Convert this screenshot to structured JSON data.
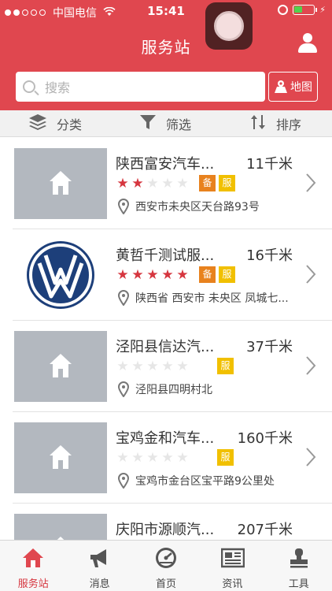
{
  "status_bar": {
    "carrier": "中国电信",
    "time": "15:41"
  },
  "header": {
    "title": "服务站"
  },
  "search": {
    "placeholder": "搜索",
    "map_label": "地图"
  },
  "filters": [
    {
      "label": "分类",
      "icon": "layers-icon"
    },
    {
      "label": "筛选",
      "icon": "funnel-icon"
    },
    {
      "label": "排序",
      "icon": "sort-arrows-icon"
    }
  ],
  "stations": [
    {
      "name": "陕西富安汽车...",
      "distance": "11千米",
      "rating": 2,
      "badges": [
        "备",
        "服"
      ],
      "address": "西安市未央区天台路93号",
      "image": "placeholder-house"
    },
    {
      "name": "黄哲千测试服...",
      "distance": "16千米",
      "rating": 5,
      "badges": [
        "备",
        "服"
      ],
      "address": "陕西省 西安市 未央区 凤城七...",
      "image": "vw-logo"
    },
    {
      "name": "泾阳县信达汽...",
      "distance": "37千米",
      "rating": 0,
      "badges": [
        "服"
      ],
      "address": "泾阳县四明村北",
      "image": "placeholder-house"
    },
    {
      "name": "宝鸡金和汽车...",
      "distance": "160千米",
      "rating": 0,
      "badges": [
        "服"
      ],
      "address": "宝鸡市金台区宝平路9公里处",
      "image": "placeholder-house"
    },
    {
      "name": "庆阳市源顺汽...",
      "distance": "207千米",
      "rating": 0,
      "badges": [],
      "address": "",
      "image": "placeholder-house"
    }
  ],
  "tabs": [
    {
      "label": "服务站",
      "icon": "house-icon",
      "active": true
    },
    {
      "label": "消息",
      "icon": "megaphone-icon",
      "active": false
    },
    {
      "label": "首页",
      "icon": "speedometer-icon",
      "active": false
    },
    {
      "label": "资讯",
      "icon": "newspaper-icon",
      "active": false
    },
    {
      "label": "工具",
      "icon": "stamp-icon",
      "active": false
    }
  ],
  "colors": {
    "brand_red": "#e0474f",
    "star_red": "#d6363f",
    "badge_orange": "#e8821e",
    "badge_yellow": "#f1c000",
    "thumb_gray": "#b3b8bf"
  }
}
